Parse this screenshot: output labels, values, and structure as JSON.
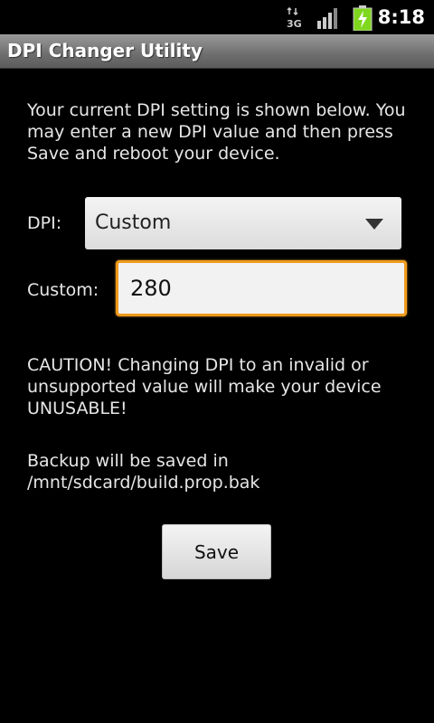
{
  "status_bar": {
    "network": "3G",
    "network_icon": "network-3g-icon",
    "signal_icon": "signal-strength-icon",
    "battery_icon": "battery-charging-icon",
    "time": "8:18"
  },
  "title_bar": {
    "title": "DPI Changer Utility"
  },
  "main": {
    "intro_text": "Your current DPI setting is shown below. You may enter a new DPI value and then press Save and reboot your device.",
    "dpi_label": "DPI:",
    "dpi_selected": "Custom",
    "custom_label": "Custom:",
    "custom_value": "280",
    "caution_text": "CAUTION! Changing DPI to an invalid or unsupported value will make your device UNUSABLE!",
    "backup_text": "Backup will be saved in /mnt/sdcard/build.prop.bak",
    "save_label": "Save"
  },
  "colors": {
    "background": "#000000",
    "input_focus": "#f09a1d",
    "battery": "#7fd81e"
  }
}
